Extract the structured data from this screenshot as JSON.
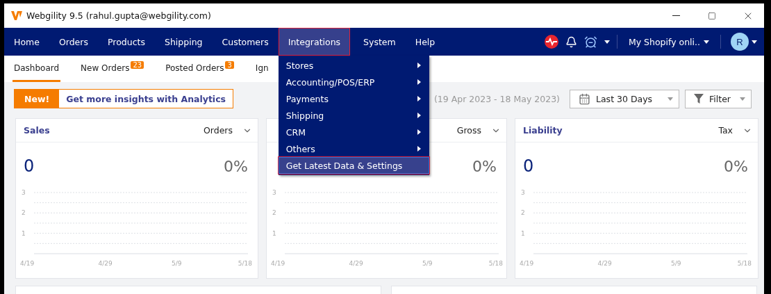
{
  "window": {
    "title": "Webgility 9.5 (rahul.gupta@webgility.com)"
  },
  "nav": {
    "items": [
      {
        "label": "Home",
        "selected": false
      },
      {
        "label": "Orders",
        "selected": false
      },
      {
        "label": "Products",
        "selected": false
      },
      {
        "label": "Shipping",
        "selected": false
      },
      {
        "label": "Customers",
        "selected": false
      },
      {
        "label": "Integrations",
        "selected": true
      },
      {
        "label": "System",
        "selected": false
      },
      {
        "label": "Help",
        "selected": false
      }
    ],
    "menu": [
      {
        "label": "Stores",
        "kind": "submenu",
        "selected": false
      },
      {
        "label": "Accounting/POS/ERP",
        "kind": "submenu",
        "selected": false
      },
      {
        "label": "Payments",
        "kind": "submenu",
        "selected": false
      },
      {
        "label": "Shipping",
        "kind": "submenu",
        "selected": false
      },
      {
        "label": "CRM",
        "kind": "submenu",
        "selected": false
      },
      {
        "label": "Others",
        "kind": "submenu",
        "selected": false
      },
      {
        "label": "Get Latest Data & Settings",
        "kind": "action",
        "selected": true
      }
    ],
    "store": "My Shopify onli..",
    "avatar": "R"
  },
  "subtabs": [
    {
      "label": "Dashboard",
      "selected": true
    },
    {
      "label": "New Orders",
      "badge": "23",
      "selected": false
    },
    {
      "label": "Posted Orders",
      "badge": "3",
      "selected": false
    },
    {
      "label": "Ign",
      "selected": false
    }
  ],
  "promo": {
    "badge": "New!",
    "link": "Get more insights with Analytics"
  },
  "date_range": "(19 Apr 2023 - 18 May 2023)",
  "range_select": "Last 30 Days",
  "filter": "Filter",
  "cards": [
    {
      "title": "Sales",
      "metric": "Orders",
      "value": "0",
      "change": "0%",
      "chart_data": {
        "type": "line",
        "categories": [
          "4/19",
          "4/29",
          "5/9",
          "5/18"
        ],
        "yticks": [
          1,
          2,
          3
        ],
        "ylim": [
          0,
          3
        ]
      }
    },
    {
      "metric": "Gross",
      "change": "0%",
      "chart_data": {
        "type": "line",
        "categories": [
          "4/19",
          "4/29",
          "5/9",
          "5/18"
        ],
        "yticks": [
          1,
          2,
          3
        ],
        "ylim": [
          0,
          3
        ]
      }
    },
    {
      "title": "Liability",
      "metric": "Tax",
      "value": "0",
      "change": "0%",
      "chart_data": {
        "type": "line",
        "categories": [
          "4/19",
          "4/29",
          "5/9",
          "5/18"
        ],
        "yticks": [
          1,
          2,
          3
        ],
        "ylim": [
          0,
          3
        ]
      }
    }
  ]
}
